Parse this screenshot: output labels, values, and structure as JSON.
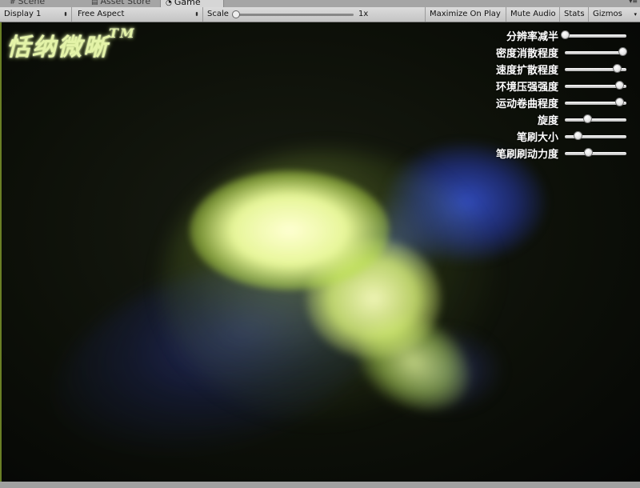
{
  "tabs": [
    {
      "label": "Scene",
      "icon": "grid-icon"
    },
    {
      "label": "Asset Store",
      "icon": "store-icon"
    },
    {
      "label": "Game",
      "icon": "pacman-icon"
    }
  ],
  "toolbar": {
    "display_dropdown": "Display 1",
    "aspect_dropdown": "Free Aspect",
    "scale_label": "Scale",
    "scale_value": "1x",
    "maximize_on_play": "Maximize On Play",
    "mute_audio": "Mute Audio",
    "stats": "Stats",
    "gizmos": "Gizmos"
  },
  "game": {
    "logo_text": "恬纳微晰",
    "logo_tm": "TM",
    "sliders": [
      {
        "label": "分辨率减半",
        "value": 0.0
      },
      {
        "label": "密度消散程度",
        "value": 0.93
      },
      {
        "label": "速度扩散程度",
        "value": 0.85
      },
      {
        "label": "环境压强强度",
        "value": 0.88
      },
      {
        "label": "运动卷曲程度",
        "value": 0.88
      },
      {
        "label": "旋度",
        "value": 0.36
      },
      {
        "label": "笔刷大小",
        "value": 0.21
      },
      {
        "label": "笔刷刷动力度",
        "value": 0.38
      }
    ]
  }
}
